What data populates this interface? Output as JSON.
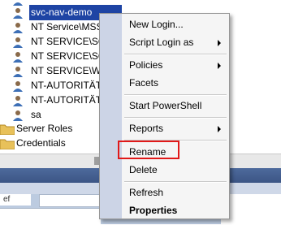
{
  "tree": {
    "rows": [
      {
        "label": "",
        "icon": "user-icon",
        "selected": false
      },
      {
        "label": "svc-nav-demo",
        "icon": "user-icon",
        "selected": true
      },
      {
        "label": "NT Service\\MSS",
        "icon": "user-icon",
        "selected": false
      },
      {
        "label": "NT SERVICE\\SQ",
        "icon": "user-icon",
        "selected": false
      },
      {
        "label": "NT SERVICE\\SQ",
        "icon": "user-icon",
        "selected": false
      },
      {
        "label": "NT SERVICE\\Win",
        "icon": "user-icon",
        "selected": false
      },
      {
        "label": "NT-AUTORITÄT",
        "icon": "user-icon",
        "selected": false
      },
      {
        "label": "NT-AUTORITÄT",
        "icon": "user-icon",
        "selected": false
      },
      {
        "label": "sa",
        "icon": "user-icon",
        "selected": false
      }
    ],
    "folders": [
      {
        "label": "Server Roles",
        "icon": "folder-icon"
      },
      {
        "label": "Credentials",
        "icon": "folder-icon"
      }
    ]
  },
  "lower_panel": {
    "tab_hint": "ef"
  },
  "context_menu": {
    "items": [
      {
        "label": "New Login...",
        "submenu": false,
        "bold": false
      },
      {
        "label": "Script Login as",
        "submenu": true,
        "bold": false
      },
      {
        "label": "Policies",
        "submenu": true,
        "bold": false
      },
      {
        "label": "Facets",
        "submenu": false,
        "bold": false
      },
      {
        "label": "Start PowerShell",
        "submenu": false,
        "bold": false
      },
      {
        "label": "Reports",
        "submenu": true,
        "bold": false
      },
      {
        "label": "Rename",
        "submenu": false,
        "bold": false,
        "highlighted": true
      },
      {
        "label": "Delete",
        "submenu": false,
        "bold": false
      },
      {
        "label": "Refresh",
        "submenu": false,
        "bold": false
      },
      {
        "label": "Properties",
        "submenu": false,
        "bold": true
      }
    ],
    "highlight_color": "#e11919",
    "gutter_color": "#ccd4e6"
  },
  "colors": {
    "selection": "#1e44a4"
  }
}
